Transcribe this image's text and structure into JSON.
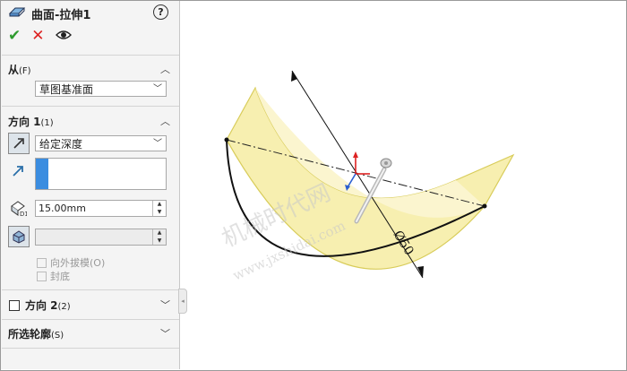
{
  "pm": {
    "title": "曲面-拉伸1",
    "help": "?",
    "ok": "✔",
    "cancel": "✕",
    "from": {
      "label": "从",
      "shortcut": "(F)",
      "value": "草图基准面"
    },
    "dir1": {
      "label": "方向 1",
      "shortcut": "(1)",
      "end_condition": "给定深度",
      "depth": "15.00mm",
      "draft_outward": "向外拔模(O)",
      "cap_end": "封底"
    },
    "dir2": {
      "label": "方向 2",
      "shortcut": "(2)"
    },
    "contours": {
      "label": "所选轮廓",
      "shortcut": "(S)"
    }
  },
  "viewport": {
    "dimension": "Ø50",
    "watermark_cn": "机械时代网",
    "watermark_url": "www.jxshidai.com"
  },
  "colors": {
    "surface": "#f7efb0",
    "surface_edge": "#d8cc5a",
    "accent_blue": "#3b8de0"
  }
}
